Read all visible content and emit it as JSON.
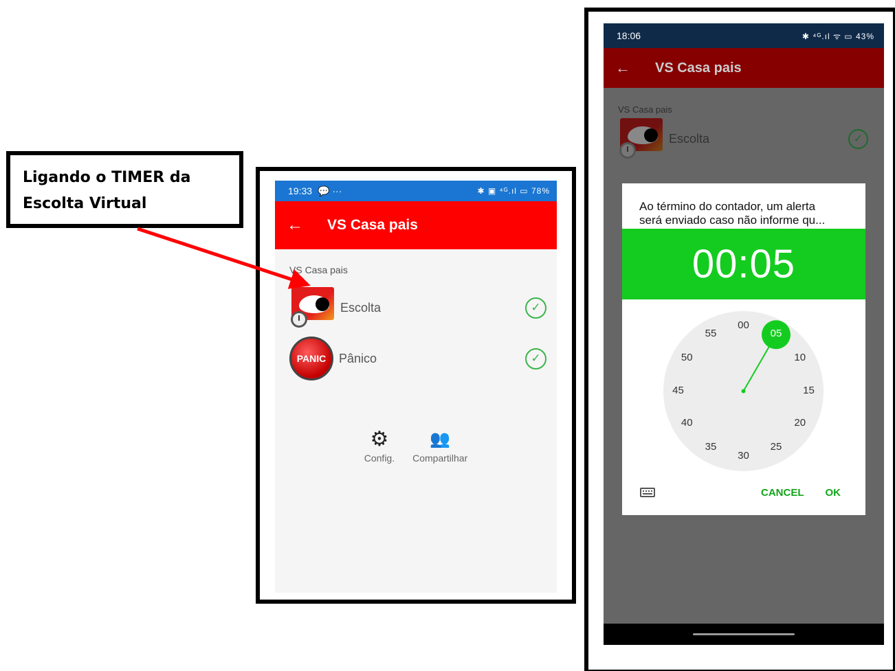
{
  "callout": {
    "line1": "Ligando o TIMER da",
    "line2": "Escolta Virtual"
  },
  "phone1": {
    "status": {
      "time": "19:33",
      "left_icons": "💬 ···",
      "right_icons": "✱ ▣ ⁴ᴳ.ıl ▭ 78%"
    },
    "appbar": {
      "back": "←",
      "title": "VS Casa pais"
    },
    "section": "VS Casa pais",
    "items": [
      {
        "label": "Escolta"
      },
      {
        "label": "Pânico",
        "icon_text": "PANIC"
      }
    ],
    "actions": [
      {
        "label": "Config.",
        "icon": "⚙"
      },
      {
        "label": "Compartilhar",
        "icon": "👥"
      }
    ],
    "accent": "#ff0000"
  },
  "phone2": {
    "status": {
      "time": "18:06",
      "right_icons": "✱ ⁴ᴳ.ıl ᯤ ▭ 43%"
    },
    "appbar": {
      "back": "←",
      "title": "VS Casa pais"
    },
    "section": "VS Casa pais",
    "items": [
      {
        "label": "Escolta"
      }
    ],
    "dialog": {
      "message_line1": "Ao término do contador, um alerta",
      "message_line2": "será enviado caso não informe qu...",
      "time_display": "00:05",
      "clock_labels": [
        "00",
        "05",
        "10",
        "15",
        "20",
        "25",
        "30",
        "35",
        "40",
        "45",
        "50",
        "55"
      ],
      "selected": "05",
      "cancel": "CANCEL",
      "ok": "OK",
      "accent": "#14cc1f"
    }
  }
}
